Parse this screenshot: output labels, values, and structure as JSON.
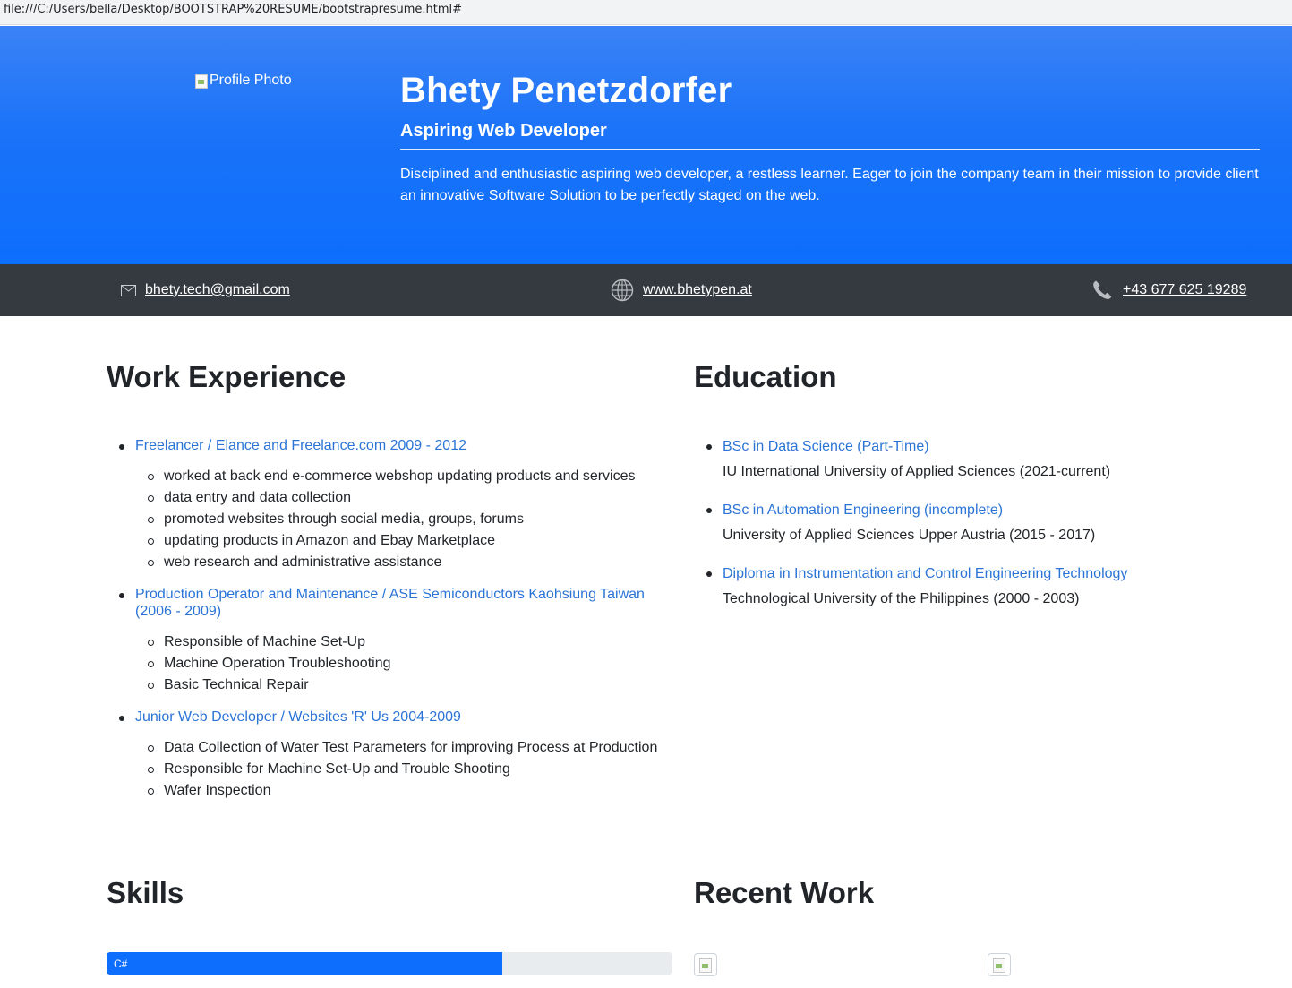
{
  "browser": {
    "url": "file:///C:/Users/bella/Desktop/BOOTSTRAP%20RESUME/bootstrapresume.html#"
  },
  "header": {
    "photo_alt": "Profile Photo",
    "name": "Bhety Penetzdorfer",
    "title": "Aspiring Web Developer",
    "summary": "Disciplined and enthusiastic aspiring web developer, a restless learner. Eager to join the company team in their mission to provide client an innovative Software Solution to be perfectly staged on the web."
  },
  "contact": {
    "email": "bhety.tech@gmail.com",
    "website": "www.bhetypen.at",
    "phone": "+43 677 625 19289",
    "icons": [
      "envelope-icon",
      "globe-icon",
      "phone-icon"
    ]
  },
  "work": {
    "heading": "Work Experience",
    "jobs": [
      {
        "title": "Freelancer / Elance and Freelance.com 2009 - 2012",
        "tasks": [
          "worked at back end e-commerce webshop updating products and services",
          "data entry and data collection",
          "promoted websites through social media, groups, forums",
          "updating products in Amazon and Ebay Marketplace",
          "web research and administrative assistance"
        ]
      },
      {
        "title": "Production Operator and Maintenance / ASE Semiconductors Kaohsiung Taiwan (2006 - 2009)",
        "tasks": [
          "Responsible of Machine Set-Up",
          "Machine Operation Troubleshooting",
          "Basic Technical Repair"
        ]
      },
      {
        "title": "Junior Web Developer / Websites 'R' Us 2004-2009",
        "tasks": [
          "Data Collection of Water Test Parameters for improving Process at Production",
          "Responsible for Machine Set-Up and Trouble Shooting",
          "Wafer Inspection"
        ]
      }
    ]
  },
  "education": {
    "heading": "Education",
    "items": [
      {
        "degree": "BSc in Data Science (Part-Time)",
        "school": "IU International University of Applied Sciences (2021-current)"
      },
      {
        "degree": "BSc in Automation Engineering (incomplete)",
        "school": "University of Applied Sciences Upper Austria (2015 - 2017)"
      },
      {
        "degree": "Diploma in Instrumentation and Control Engineering Technology",
        "school": "Technological University of the Philippines (2000 - 2003)"
      }
    ]
  },
  "skills": {
    "heading": "Skills",
    "items": [
      {
        "name": "C#",
        "percent": 70
      }
    ]
  },
  "recent_work": {
    "heading": "Recent Work"
  },
  "colors": {
    "hero_blue": "#0d6efd",
    "contact_bar": "#343a40",
    "link_blue": "#2b74d6"
  }
}
